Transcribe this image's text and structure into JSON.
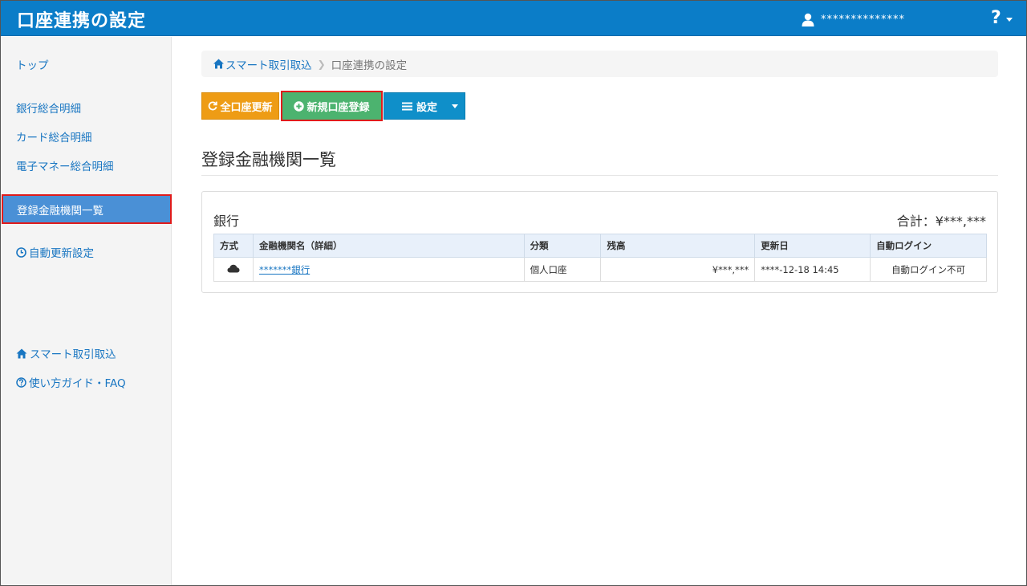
{
  "header": {
    "title": "口座連携の設定",
    "user_name": "**************",
    "help_glyph": "?"
  },
  "sidebar": {
    "items": [
      {
        "label": "トップ"
      },
      {
        "label": "銀行総合明細"
      },
      {
        "label": "カード総合明細"
      },
      {
        "label": "電子マネー総合明細"
      },
      {
        "label": "登録金融機関一覧"
      },
      {
        "label": "自動更新設定"
      },
      {
        "label": "スマート取引取込"
      },
      {
        "label": "使い方ガイド・FAQ"
      }
    ]
  },
  "breadcrumb": {
    "parent": "スマート取引取込",
    "current": "口座連携の設定"
  },
  "toolbar": {
    "refresh_label": "全口座更新",
    "new_label": "新規口座登録",
    "settings_label": "設定"
  },
  "section": {
    "title": "登録金融機関一覧"
  },
  "panel": {
    "title": "銀行",
    "total": "合計：¥***,***",
    "columns": [
      "方式",
      "金融機関名（詳細）",
      "分類",
      "残高",
      "更新日",
      "自動ログイン"
    ],
    "rows": [
      {
        "method_icon": "cloud-icon",
        "name": "*******銀行",
        "category": "個人口座",
        "balance": "¥***,***",
        "updated": "****-12-18 14:45",
        "auto_login": "自動ログイン不可"
      }
    ]
  }
}
